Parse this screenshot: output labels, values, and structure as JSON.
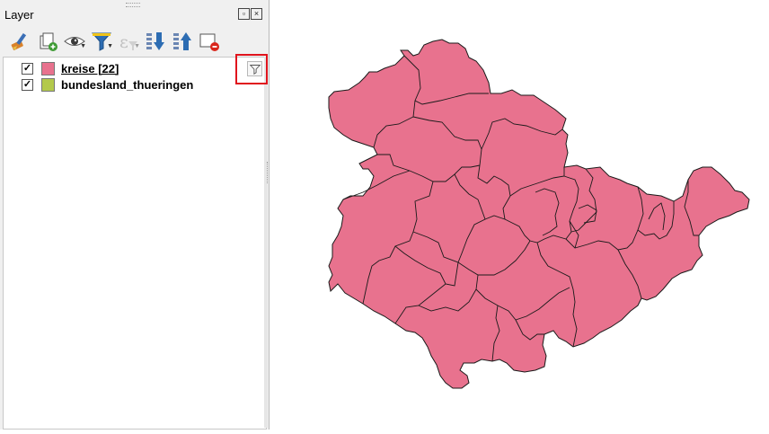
{
  "panel": {
    "title": "Layer"
  },
  "toolbar": {
    "buttons": [
      {
        "name": "open-layer-styling-icon"
      },
      {
        "name": "add-group-icon"
      },
      {
        "name": "manage-visibility-icon"
      },
      {
        "name": "filter-legend-icon"
      },
      {
        "name": "filter-expression-icon"
      },
      {
        "name": "expand-all-icon"
      },
      {
        "name": "collapse-all-icon"
      },
      {
        "name": "remove-layer-icon"
      }
    ]
  },
  "layers": [
    {
      "label": "kreise [22]",
      "checked": "✓",
      "color": "#e8728e"
    },
    {
      "label": "bundesland_thueringen",
      "checked": "✓",
      "color": "#b3c94b"
    }
  ],
  "map": {
    "fill_color": "#e8728e",
    "stroke_color": "#1a1a1a",
    "highlight_color": "#e0141d"
  }
}
